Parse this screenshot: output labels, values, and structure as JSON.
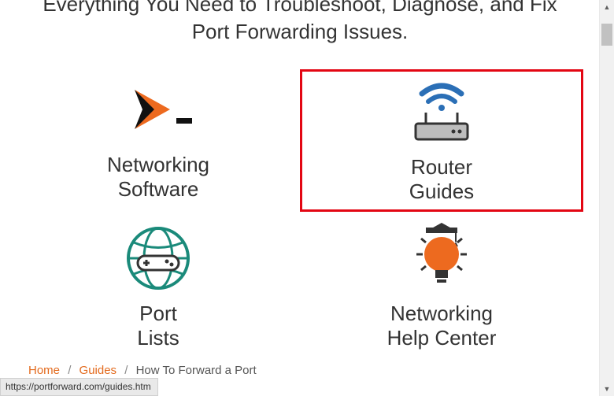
{
  "headline": "Everything You Need to Troubleshoot, Diagnose, and Fix Port Forwarding Issues.",
  "cards": {
    "networking_software": {
      "line1": "Networking",
      "line2": "Software"
    },
    "router_guides": {
      "line1": "Router",
      "line2": "Guides"
    },
    "port_lists": {
      "line1": "Port",
      "line2": "Lists"
    },
    "help_center": {
      "line1": "Networking",
      "line2": "Help Center"
    }
  },
  "breadcrumbs": {
    "home": "Home",
    "guides": "Guides",
    "current": "How To Forward a Port"
  },
  "status_url": "https://portforward.com/guides.htm"
}
